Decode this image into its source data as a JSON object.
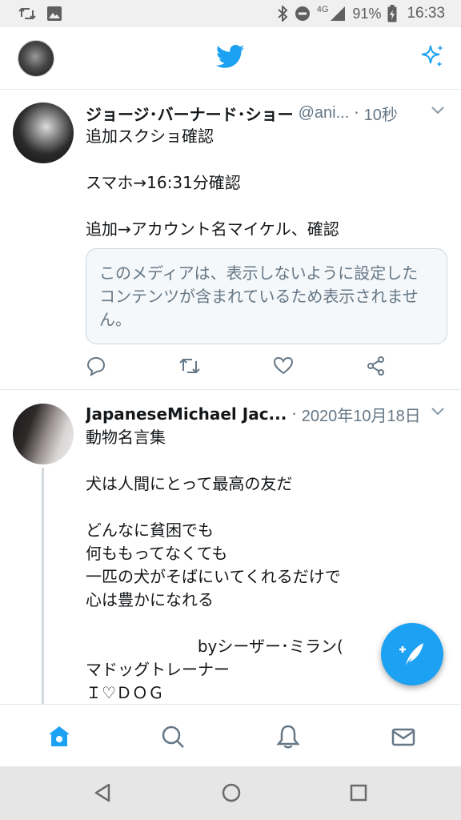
{
  "status_bar": {
    "battery": "91%",
    "network": "4G",
    "time": "16:33",
    "icons_left": [
      "retweet-notification-icon",
      "image-notification-icon"
    ],
    "icons_right": [
      "bluetooth-icon",
      "do-not-disturb-icon",
      "signal-icon",
      "battery-icon"
    ]
  },
  "header": {
    "logo": "twitter-bird-icon",
    "action": "sparkle-icon"
  },
  "tweets": [
    {
      "name": "ジョージ･バーナード･ショー",
      "handle": "@ani...",
      "separator": "·",
      "time": "10秒",
      "text": "追加スクショ確認\n\nスマホ→16:31分確認\n\n追加→アカウント名マイケル、確認",
      "media_notice": "このメディアは、表示しないように設定したコンテンツが含まれているため表示されません。"
    },
    {
      "name": "JapaneseMichael Jac...",
      "separator": "·",
      "time": "2020年10月18日",
      "text": "動物名言集\n\n犬は人間にとって最高の友だ\n\nどんなに貧困でも\n何ももってなくても\n一匹の犬がそばにいてくれるだけで\n心は豊かになれる\n\n                      byシーザー･ミラン(\nマドッグトレーナー\nＩ♡ＤＯＧ"
    }
  ],
  "actions": [
    "reply-icon",
    "retweet-icon",
    "like-icon",
    "share-icon"
  ],
  "tabs": [
    "home-tab",
    "search-tab",
    "notifications-tab",
    "messages-tab"
  ],
  "navigation": [
    "back-icon",
    "home-icon",
    "recents-icon"
  ],
  "colors": {
    "accent": "#1da1f2",
    "text": "#14171a",
    "secondary": "#657786"
  }
}
